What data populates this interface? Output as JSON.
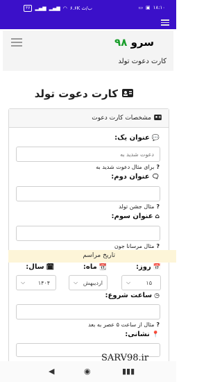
{
  "statusbar": {
    "time": "۱۸:۱۰",
    "speed": "۶.۶K ب/ث",
    "battery": "۳۶"
  },
  "header": {
    "brand_text": "سرو",
    "brand_num": "۹۸"
  },
  "breadcrumb": {
    "text": "کارت دعوت تولد"
  },
  "page": {
    "title": "کارت دعوت تولد"
  },
  "card": {
    "header": "مشخصات کارت دعوت"
  },
  "form": {
    "title1": {
      "label": "عنوان یک:",
      "value": "دعوت شدید به",
      "help": "برای مثال دعوت شدید به"
    },
    "title2": {
      "label": "عنوان دوم:",
      "value": "",
      "help": "مثال جشن تولد"
    },
    "title3": {
      "label": "عنوان سوم:",
      "value": "",
      "help": "مثال مرسانا جون"
    },
    "ceremony_date": {
      "title": "تاریخ مراسم"
    },
    "day": {
      "label": "روز:",
      "value": "۱۵"
    },
    "month": {
      "label": "ماه:",
      "value": "اردیبهش"
    },
    "year": {
      "label": "سال:",
      "value": "۱۴۰۴"
    },
    "start_time": {
      "label": "ساعت شروع:",
      "value": "",
      "help": "مثال از ساعت ۵ عصر به بعد"
    },
    "address": {
      "label": "نشانی:"
    }
  },
  "watermark": "SARV98.ir"
}
